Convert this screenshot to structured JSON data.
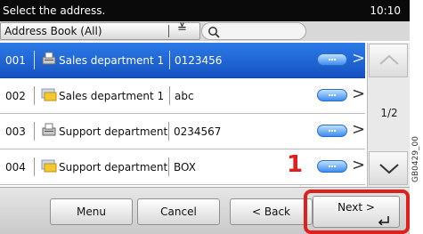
{
  "header": {
    "title": "Select the address.",
    "time": "10:10"
  },
  "filter": {
    "selected": "Address Book (All)"
  },
  "rows": [
    {
      "num": "001",
      "name": "Sales department 1",
      "address": "0123456",
      "selected": true,
      "icon": "fax-icon"
    },
    {
      "num": "002",
      "name": "Sales department 1",
      "address": "abc",
      "selected": false,
      "icon": "folder-icon"
    },
    {
      "num": "003",
      "name": "Support department",
      "address": "0234567",
      "selected": false,
      "icon": "fax-icon"
    },
    {
      "num": "004",
      "name": "Support department",
      "address": "BOX",
      "selected": false,
      "icon": "folder-icon"
    }
  ],
  "pager": {
    "page": "1/2"
  },
  "buttons": {
    "menu": "Menu",
    "cancel": "Cancel",
    "back": "< Back",
    "next": "Next >"
  },
  "annotation": {
    "callout": "1",
    "code": "GB0429_00"
  },
  "colors": {
    "selected_row": "#1f62d4",
    "highlight": "#e0201c",
    "topbar": "#0a0a0a"
  }
}
